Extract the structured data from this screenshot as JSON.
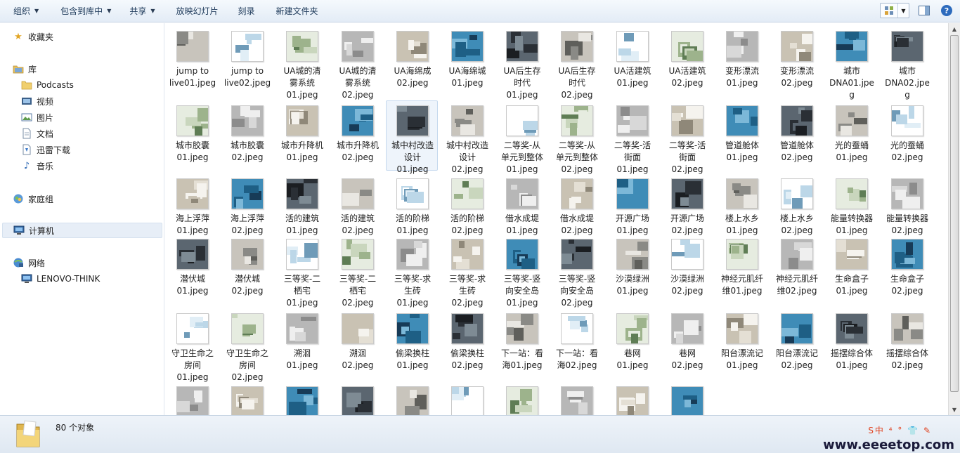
{
  "toolbar": {
    "organize": "组织",
    "include_library": "包含到库中",
    "share": "共享",
    "slideshow": "放映幻灯片",
    "burn": "刻录",
    "new_folder": "新建文件夹"
  },
  "nav": {
    "favorites": "收藏夹",
    "libraries": "库",
    "lib_items": [
      "Podcasts",
      "视频",
      "图片",
      "文档",
      "迅雷下载",
      "音乐"
    ],
    "homegroup": "家庭组",
    "computer": "计算机",
    "network": "网络",
    "network_items": [
      "LENOVO-THINK"
    ]
  },
  "status": {
    "count": "80 个对象"
  },
  "watermark": {
    "url": "www.eeeetop.com",
    "icons": "S中 ⁴ ° 👕 ✎"
  },
  "files": [
    [
      "jump to\nlive01.jpeg",
      "jump to\nlive02.jpeg",
      "UA城的清\n雾系统\n01.jpeg",
      "UA城的清\n雾系统\n02.jpeg",
      "UA海绵成\n02.jpeg",
      "UA海绵城\n01.jpeg",
      "UA后生存\n时代\n01.jpeg",
      "UA后生存\n时代\n02.jpeg",
      "UA活建筑\n01.jpeg",
      "UA活建筑\n02.jpeg",
      "变形漂流\n01.jpeg",
      "变形漂流\n02.jpeg",
      "城市\nDNA01.jpe\ng",
      "城市\nDNA02.jpe\ng"
    ],
    [
      "城市胶囊\n01.jpeg",
      "城市胶囊\n02.jpeg",
      "城市升降机\n01.jpeg",
      "城市升降机\n02.jpeg",
      "城中村改造\n设计\n01.jpeg",
      "城中村改造\n设计\n02.jpeg",
      "二等奖-从\n单元到整体\n01.jpeg",
      "二等奖-从\n单元到整体\n02.jpeg",
      "二等奖-活\n街面\n01.jpeg",
      "二等奖-活\n街面\n02.jpeg",
      "管道舱体\n01.jpeg",
      "管道舱体\n02.jpeg",
      "光的蚕蛹\n01.jpeg",
      "光的蚕蛹\n02.jpeg"
    ],
    [
      "海上浮萍\n01.jpeg",
      "海上浮萍\n02.jpeg",
      "活的建筑\n01.jpeg",
      "活的建筑\n02.jpeg",
      "活的阶梯\n01.jpeg",
      "活的阶梯\n02.jpeg",
      "借水成堤\n01.jpeg",
      "借水成堤\n02.jpeg",
      "开源广场\n01.jpeg",
      "开源广场\n02.jpeg",
      "楼上水乡\n01.jpeg",
      "楼上水乡\n02.jpeg",
      "能量转换器\n01.jpeg",
      "能量转换器\n02.jpeg"
    ],
    [
      "潜伏城\n01.jpeg",
      "潜伏城\n02.jpeg",
      "三等奖-二\n栖宅\n01.jpeg",
      "三等奖-二\n栖宅\n02.jpeg",
      "三等奖-求\n生砖\n01.jpeg",
      "三等奖-求\n生砖\n02.jpeg",
      "三等奖-竖\n向安全岛\n01.jpeg",
      "三等奖-竖\n向安全岛\n02.jpeg",
      "沙漠绿洲\n01.jpeg",
      "沙漠绿洲\n02.jpeg",
      "神经元肌纤\n维01.jpeg",
      "神经元肌纤\n维02.jpeg",
      "生命盒子\n01.jpeg",
      "生命盒子\n02.jpeg"
    ],
    [
      "守卫生命之\n房间\n01.jpeg",
      "守卫生命之\n房间\n02.jpeg",
      "溯洄\n01.jpeg",
      "溯洄\n02.jpeg",
      "偷梁换柱\n01.jpeg",
      "偷梁换柱\n02.jpeg",
      "下一站：看\n海01.jpeg",
      "下一站：看\n海02.jpeg",
      "巷网\n01.jpeg",
      "巷网\n02.jpeg",
      "阳台漂流记\n01.jpeg",
      "阳台漂流记\n02.jpeg",
      "摇摆综合体\n01.jpeg",
      "摇摆综合体\n02.jpeg"
    ],
    [
      "",
      "",
      "",
      "",
      "",
      "",
      "",
      "",
      "",
      ""
    ]
  ],
  "thumb_styles": [
    "grey",
    "light",
    "dark",
    "green",
    "blue",
    "sky",
    "pale"
  ]
}
